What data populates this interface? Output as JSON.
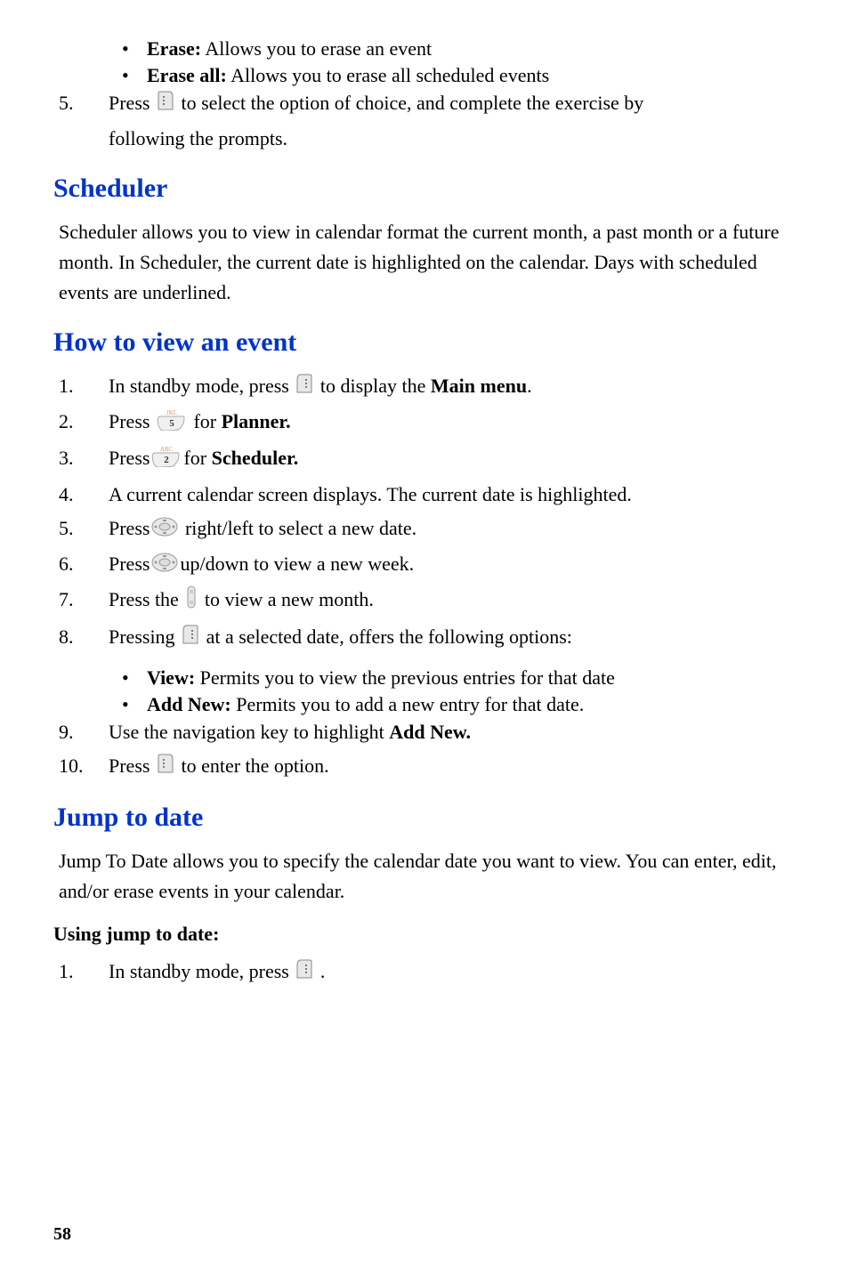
{
  "bullets_top": [
    {
      "label": "Erase:",
      "text": " Allows you to erase an event"
    },
    {
      "label": "Erase all:",
      "text": " Allows you to erase all scheduled events"
    }
  ],
  "step5_top": {
    "num": "5.",
    "before": "Press ",
    "after1": " to select the option of choice, and complete the exercise by",
    "after2": "following the prompts."
  },
  "scheduler": {
    "heading": "Scheduler",
    "body": "Scheduler allows you to view in calendar format the current month, a past month or a future month. In Scheduler, the current date is highlighted on the calendar. Days with scheduled events are underlined."
  },
  "how_view": {
    "heading": "How to view an event",
    "steps": {
      "1": {
        "num": "1.",
        "before": "In standby mode, press ",
        "after": " to display the ",
        "bold": "Main menu",
        "suffix": "."
      },
      "2": {
        "num": "2.",
        "before": "Press ",
        "after": " for ",
        "bold": "Planner."
      },
      "3": {
        "num": "3.",
        "before": "Press",
        "after": "for ",
        "bold": "Scheduler."
      },
      "4": {
        "num": "4.",
        "text": "A current calendar screen displays. The current date is highlighted."
      },
      "5": {
        "num": "5.",
        "before": "Press",
        "after": " right/left to select a new date."
      },
      "6": {
        "num": "6.",
        "before": "Press",
        "after": "up/down to view a new week."
      },
      "7": {
        "num": "7.",
        "before": "Press the ",
        "after": " to view a new month."
      },
      "8": {
        "num": "8.",
        "before": "Pressing ",
        "after": " at a selected date, offers the following options:"
      }
    },
    "sub_bullets": [
      {
        "label": "View:",
        "text": " Permits you to view the previous entries for that date"
      },
      {
        "label": "Add New:",
        "text": " Permits you to add a new entry for that date."
      }
    ],
    "step9": {
      "num": "9.",
      "before": "Use the navigation key to highlight ",
      "bold": "Add New."
    },
    "step10": {
      "num": "10.",
      "before": "Press ",
      "after": " to enter the option."
    }
  },
  "jump": {
    "heading": "Jump to date",
    "body": "Jump To Date allows you to specify the calendar date you want to view. You can enter, edit, and/or erase events in your calendar.",
    "subheading": "Using jump to date:",
    "step1": {
      "num": "1.",
      "before": "In standby mode, press ",
      "after": " ."
    }
  },
  "page_number": "58"
}
